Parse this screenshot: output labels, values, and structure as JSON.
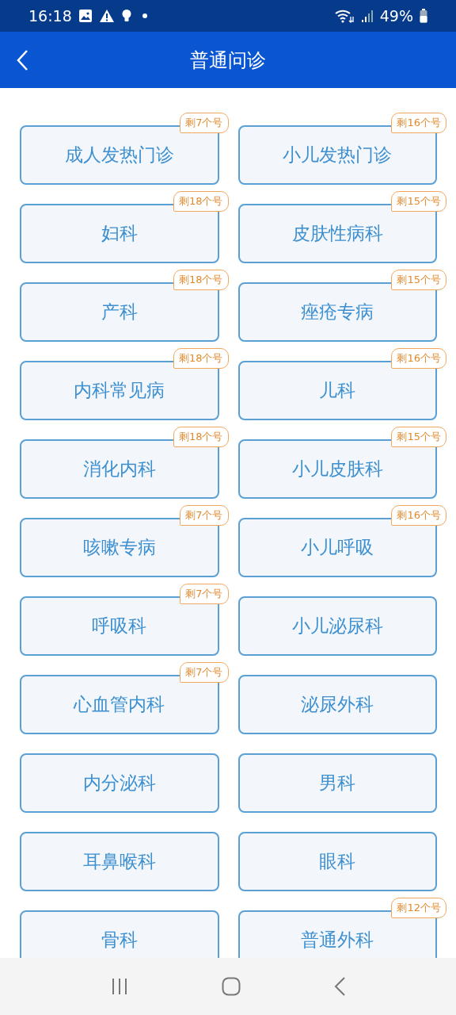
{
  "status_bar": {
    "time": "16:18",
    "battery": "49%"
  },
  "header": {
    "title": "普通问诊"
  },
  "departments": [
    {
      "name": "成人发热门诊",
      "badge": "剩7个号"
    },
    {
      "name": "小儿发热门诊",
      "badge": "剩16个号"
    },
    {
      "name": "妇科",
      "badge": "剩18个号"
    },
    {
      "name": "皮肤性病科",
      "badge": "剩15个号"
    },
    {
      "name": "产科",
      "badge": "剩18个号"
    },
    {
      "name": "痤疮专病",
      "badge": "剩15个号"
    },
    {
      "name": "内科常见病",
      "badge": "剩18个号"
    },
    {
      "name": "儿科",
      "badge": "剩16个号"
    },
    {
      "name": "消化内科",
      "badge": "剩18个号"
    },
    {
      "name": "小儿皮肤科",
      "badge": "剩15个号"
    },
    {
      "name": "咳嗽专病",
      "badge": "剩7个号"
    },
    {
      "name": "小儿呼吸",
      "badge": "剩16个号"
    },
    {
      "name": "呼吸科",
      "badge": "剩7个号"
    },
    {
      "name": "小儿泌尿科"
    },
    {
      "name": "心血管内科",
      "badge": "剩7个号"
    },
    {
      "name": "泌尿外科"
    },
    {
      "name": "内分泌科"
    },
    {
      "name": "男科"
    },
    {
      "name": "耳鼻喉科"
    },
    {
      "name": "眼科"
    },
    {
      "name": "骨科"
    },
    {
      "name": "普通外科",
      "badge": "剩12个号"
    }
  ]
}
